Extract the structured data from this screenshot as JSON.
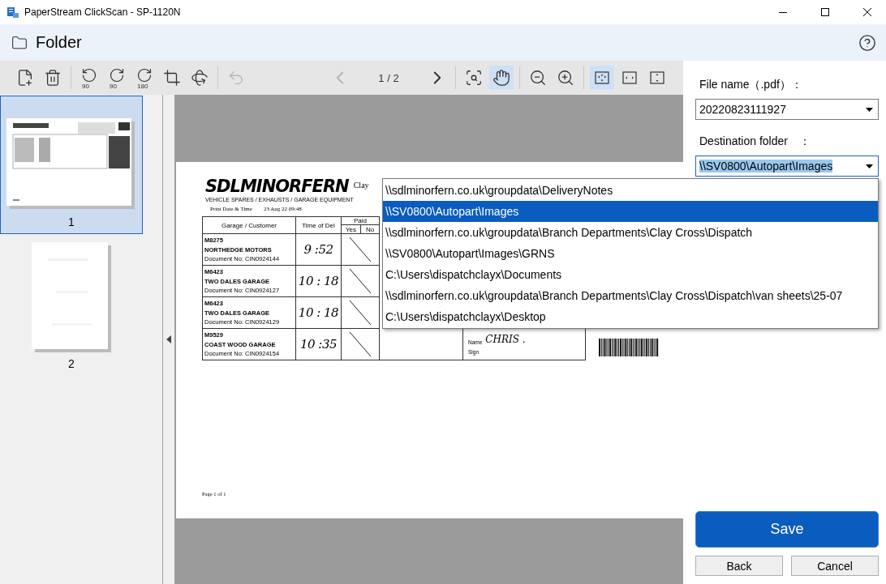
{
  "window": {
    "title": "PaperStream ClickScan - SP-1120N"
  },
  "header": {
    "title": "Folder"
  },
  "toolbar": {
    "tools": [
      {
        "kind": "add-page",
        "disabled": false,
        "selected": false
      },
      {
        "kind": "delete",
        "disabled": false,
        "selected": false
      },
      {
        "kind": "separator"
      },
      {
        "kind": "rotate-left",
        "label": "90",
        "disabled": false,
        "selected": false
      },
      {
        "kind": "rotate-right",
        "label": "90",
        "disabled": false,
        "selected": false
      },
      {
        "kind": "rotate-right",
        "label": "180",
        "disabled": false,
        "selected": false
      },
      {
        "kind": "crop",
        "disabled": false,
        "selected": false
      },
      {
        "kind": "deskew",
        "disabled": false,
        "selected": false
      },
      {
        "kind": "separator"
      },
      {
        "kind": "undo",
        "disabled": true,
        "selected": false
      },
      {
        "kind": "spacer"
      },
      {
        "kind": "previous",
        "disabled": true,
        "selected": false
      },
      {
        "kind": "counter",
        "label": "1 / 2"
      },
      {
        "kind": "next",
        "disabled": false,
        "selected": false
      },
      {
        "kind": "separator"
      },
      {
        "kind": "zoom-area",
        "disabled": false,
        "selected": false
      },
      {
        "kind": "hand",
        "disabled": false,
        "selected": true
      },
      {
        "kind": "separator"
      },
      {
        "kind": "zoom-out",
        "disabled": false,
        "selected": false
      },
      {
        "kind": "zoom-in",
        "disabled": false,
        "selected": false
      },
      {
        "kind": "separator"
      },
      {
        "kind": "fit-page",
        "disabled": false,
        "selected": true
      },
      {
        "kind": "fit-width",
        "disabled": false,
        "selected": false
      },
      {
        "kind": "fit-height",
        "disabled": false,
        "selected": false
      }
    ]
  },
  "thumbnails": [
    {
      "label": "1",
      "selected": true,
      "kind": "landscape"
    },
    {
      "label": "2",
      "selected": false,
      "kind": "portrait"
    }
  ],
  "document": {
    "logo": "SDLMINORFERN",
    "branch": "Clay",
    "tagline": "VEHICLE SPARES / EXHAUSTS / GARAGE EQUIPMENT",
    "print_label": "Print Date & Time",
    "print_value": "23 Aug 22  09:48",
    "columns": {
      "customer": "Garage / Customer",
      "time": "Time of Del",
      "paid": "Paid",
      "yes": "Yes",
      "no": "No"
    },
    "rows": [
      {
        "code": "M8275",
        "name": "NORTHEDGE MOTORS",
        "document": "Document No:  CIN0924144",
        "time": "9 :52",
        "paid_mark": true
      },
      {
        "code": "M6423",
        "name": "TWO DALES GARAGE",
        "document": "Document No:  CIN0924127",
        "time": "10 : 18",
        "paid_mark": true
      },
      {
        "code": "M6423",
        "name": "TWO DALES GARAGE",
        "document": "Document No:  CIN0924129",
        "time": "10 : 18",
        "paid_mark": true
      },
      {
        "code": "M9529",
        "name": "COAST WOOD GARAGE",
        "document": "Document No:  CIN0924154",
        "time": "10 :35",
        "paid_mark": true,
        "signature": {
          "name_label": "Name",
          "name_value": "CHRIS .",
          "sign_label": "Sign"
        },
        "barcode": true
      }
    ],
    "footer": "Page 1 of 1"
  },
  "form": {
    "file_name": {
      "label": "File name（.pdf）：",
      "value": "20220823111927"
    },
    "destination": {
      "label": "Destination folder　：",
      "value": "\\\\SV0800\\Autopart\\Images",
      "expanded": true,
      "options": [
        {
          "label": "\\\\sdlminorfern.co.uk\\groupdata\\DeliveryNotes",
          "selected": false
        },
        {
          "label": "\\\\SV0800\\Autopart\\Images",
          "selected": true
        },
        {
          "label": "\\\\sdlminorfern.co.uk\\groupdata\\Branch Departments\\Clay Cross\\Dispatch",
          "selected": false
        },
        {
          "label": "\\\\SV0800\\Autopart\\Images\\GRNS",
          "selected": false
        },
        {
          "label": "C:\\Users\\dispatchclayx\\Documents",
          "selected": false
        },
        {
          "label": "\\\\sdlminorfern.co.uk\\groupdata\\Branch Departments\\Clay Cross\\Dispatch\\van sheets\\25-07",
          "selected": false
        },
        {
          "label": "C:\\Users\\dispatchclayx\\Desktop",
          "selected": false
        }
      ]
    }
  },
  "buttons": {
    "save": "Save",
    "back": "Back",
    "cancel": "Cancel"
  }
}
